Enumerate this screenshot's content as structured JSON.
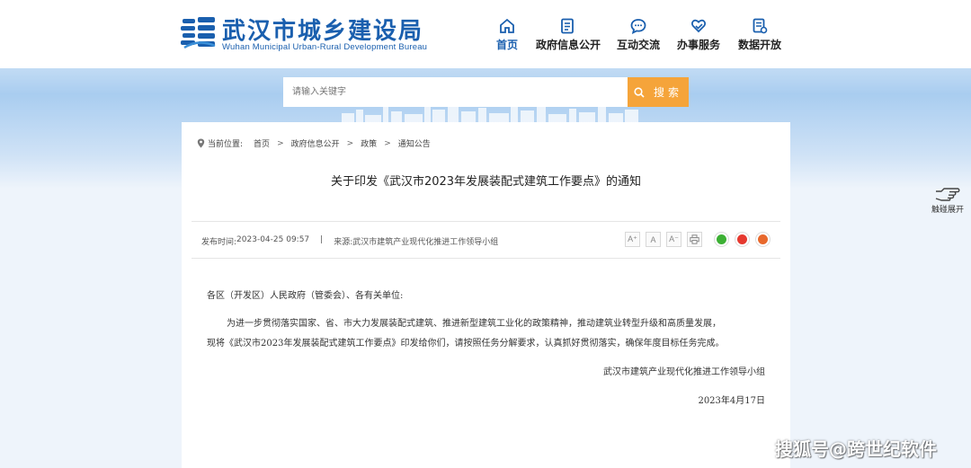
{
  "header": {
    "logo_cn": "武汉市城乡建设局",
    "logo_en": "Wuhan Municipal Urban-Rural Development Bureau",
    "nav": [
      {
        "label": "首页",
        "icon": "home-icon"
      },
      {
        "label": "政府信息公开",
        "icon": "document-icon"
      },
      {
        "label": "互动交流",
        "icon": "chat-icon"
      },
      {
        "label": "办事服务",
        "icon": "heart-hand-icon"
      },
      {
        "label": "数据开放",
        "icon": "data-icon"
      }
    ]
  },
  "search": {
    "placeholder": "请输入关键字",
    "button_label": "搜索"
  },
  "breadcrumb": {
    "prefix": "当前位置:",
    "items": [
      "首页",
      "政府信息公开",
      "政策",
      "通知公告"
    ],
    "separator": ">"
  },
  "article": {
    "title": "关于印发《武汉市2023年发展装配式建筑工作要点》的通知",
    "publish_label": "发布时间:",
    "publish_time": "2023-04-25 09:57",
    "meta_separator": "|",
    "source_label": "来源:",
    "source": "武汉市建筑产业现代化推进工作领导小组",
    "font_buttons": [
      "A⁺",
      "A",
      "A⁻"
    ],
    "salutation": "各区（开发区）人民政府（管委会）、各有关单位:",
    "para_line1": "为进一步贯彻落实国家、省、市大力发展装配式建筑、推进新型建筑工业化的政策精神，推动建筑业转型升级和高质量发展，",
    "para_line2": "现将《武汉市2023年发展装配式建筑工作要点》印发给你们，请按照任务分解要求，认真抓好贯彻落实，确保年度目标任务完成。",
    "signature": "武汉市建筑产业现代化推进工作领导小组",
    "date": "2023年4月17日"
  },
  "side": {
    "label": "触碰展开"
  },
  "watermark": "搜狐号@跨世纪软件",
  "colors": {
    "brand_blue": "#1a5fae",
    "search_orange": "#f5a43a",
    "wechat_green": "#3cb034",
    "weibo_red": "#e6392f",
    "qq_orange": "#e8682c"
  }
}
